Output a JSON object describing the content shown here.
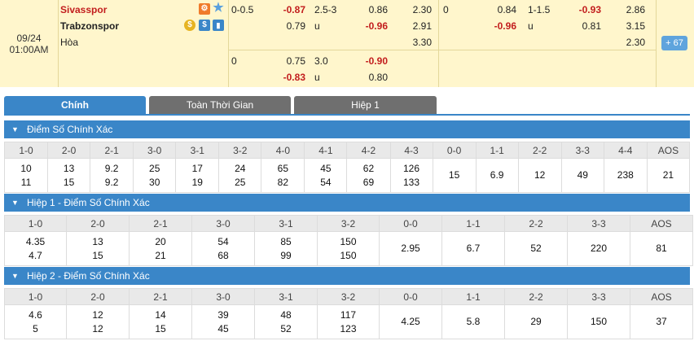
{
  "match": {
    "date": "09/24",
    "time": "01:00AM",
    "home_team": "Sivasspor",
    "away_team": "Trabzonspor",
    "draw_label": "Hòa",
    "badge_count": "67"
  },
  "odds": {
    "row1": {
      "hcp": "0-0.5",
      "hcp_home": "-0.87",
      "ou": "2.5-3",
      "ou_over": "0.86",
      "x_home": "2.30",
      "h1_hcp": "0",
      "h1_home": "0.84",
      "h1_ou": "1-1.5",
      "h1_over": "-0.93",
      "h1_x_home": "2.86"
    },
    "row2": {
      "hcp_away": "0.79",
      "ou_u": "u",
      "ou_under": "-0.96",
      "x_away": "2.91",
      "h1_away": "-0.96",
      "h1_u": "u",
      "h1_under": "0.81",
      "h1_x_away": "3.15"
    },
    "row3": {
      "x_draw": "3.30",
      "h1_x_draw": "2.30"
    },
    "row4": {
      "hcp": "0",
      "hcp_home": "0.75",
      "ou": "3.0",
      "ou_over": "-0.90"
    },
    "row5": {
      "hcp_away": "-0.83",
      "ou_u": "u",
      "ou_under": "0.80"
    }
  },
  "tabs": [
    "Chính",
    "Toàn Thời Gian",
    "Hiệp 1"
  ],
  "sections": [
    {
      "title": "Điểm Số Chính Xác",
      "cols": [
        {
          "h": "1-0",
          "a": "10",
          "b": "11"
        },
        {
          "h": "2-0",
          "a": "13",
          "b": "15"
        },
        {
          "h": "2-1",
          "a": "9.2",
          "b": "9.2"
        },
        {
          "h": "3-0",
          "a": "25",
          "b": "30"
        },
        {
          "h": "3-1",
          "a": "17",
          "b": "19"
        },
        {
          "h": "3-2",
          "a": "24",
          "b": "25"
        },
        {
          "h": "4-0",
          "a": "65",
          "b": "82"
        },
        {
          "h": "4-1",
          "a": "45",
          "b": "54"
        },
        {
          "h": "4-2",
          "a": "62",
          "b": "69"
        },
        {
          "h": "4-3",
          "a": "126",
          "b": "133"
        },
        {
          "h": "0-0",
          "s": "15"
        },
        {
          "h": "1-1",
          "s": "6.9"
        },
        {
          "h": "2-2",
          "s": "12"
        },
        {
          "h": "3-3",
          "s": "49"
        },
        {
          "h": "4-4",
          "s": "238"
        },
        {
          "h": "AOS",
          "s": "21"
        }
      ]
    },
    {
      "title": "Hiệp 1 - Điểm Số Chính Xác",
      "cols": [
        {
          "h": "1-0",
          "a": "4.35",
          "b": "4.7"
        },
        {
          "h": "2-0",
          "a": "13",
          "b": "15"
        },
        {
          "h": "2-1",
          "a": "20",
          "b": "21"
        },
        {
          "h": "3-0",
          "a": "54",
          "b": "68"
        },
        {
          "h": "3-1",
          "a": "85",
          "b": "99"
        },
        {
          "h": "3-2",
          "a": "150",
          "b": "150"
        },
        {
          "h": "0-0",
          "s": "2.95"
        },
        {
          "h": "1-1",
          "s": "6.7"
        },
        {
          "h": "2-2",
          "s": "52"
        },
        {
          "h": "3-3",
          "s": "220"
        },
        {
          "h": "AOS",
          "s": "81"
        }
      ]
    },
    {
      "title": "Hiệp 2 - Điểm Số Chính Xác",
      "cols": [
        {
          "h": "1-0",
          "a": "4.6",
          "b": "5"
        },
        {
          "h": "2-0",
          "a": "12",
          "b": "12"
        },
        {
          "h": "2-1",
          "a": "14",
          "b": "15"
        },
        {
          "h": "3-0",
          "a": "39",
          "b": "45"
        },
        {
          "h": "3-1",
          "a": "48",
          "b": "52"
        },
        {
          "h": "3-2",
          "a": "117",
          "b": "123"
        },
        {
          "h": "0-0",
          "s": "4.25"
        },
        {
          "h": "1-1",
          "s": "5.8"
        },
        {
          "h": "2-2",
          "s": "29"
        },
        {
          "h": "3-3",
          "s": "150"
        },
        {
          "h": "AOS",
          "s": "37"
        }
      ]
    }
  ],
  "colors": {
    "accent": "#3a86c8",
    "tab_inactive": "#6f6f6f",
    "top_bg": "#fff6cc",
    "red": "#c21d1d"
  },
  "icons": [
    "stats-icon",
    "star-icon",
    "money-icon",
    "dollar-icon",
    "bar-chart-icon",
    "chevron-down-icon"
  ]
}
